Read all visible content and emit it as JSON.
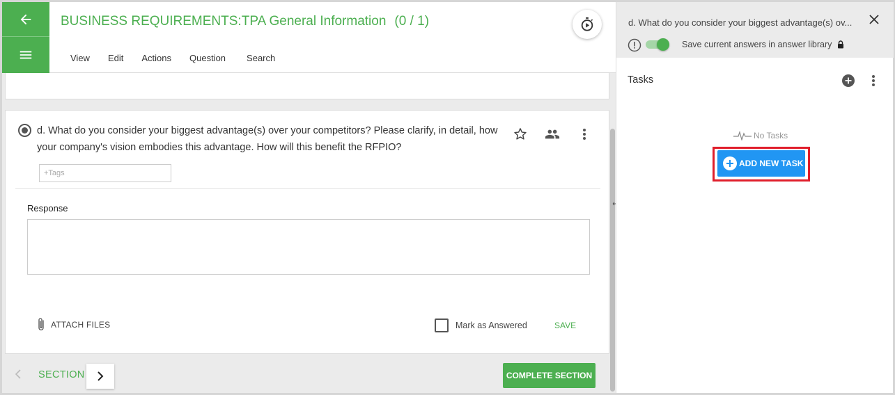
{
  "header": {
    "title": "BUSINESS REQUIREMENTS:TPA General Information",
    "count": "(0 / 1)",
    "menu": [
      "View",
      "Edit",
      "Actions",
      "Question",
      "Search"
    ]
  },
  "question": {
    "text": "d. What do you consider your biggest advantage(s) over your competitors? Please clarify, in detail, how your company's vision embodies this advantage. How will this benefit the RFPIO?",
    "tags_placeholder": "+Tags",
    "response_label": "Response",
    "attach_label": "ATTACH FILES",
    "mark_answered_label": "Mark as Answered",
    "save_label": "SAVE"
  },
  "footer": {
    "section_label": "SECTION",
    "complete_label": "COMPLETE SECTION"
  },
  "panel": {
    "title": "d. What do you consider your biggest advantage(s) ov...",
    "save_answers_label": "Save current answers in answer library",
    "tasks_label": "Tasks",
    "no_tasks_label": "No Tasks",
    "add_task_label": "ADD NEW TASK"
  },
  "colors": {
    "brand_green": "#4caf50",
    "add_task_blue": "#2196f3",
    "highlight_red": "#e01e2b"
  }
}
